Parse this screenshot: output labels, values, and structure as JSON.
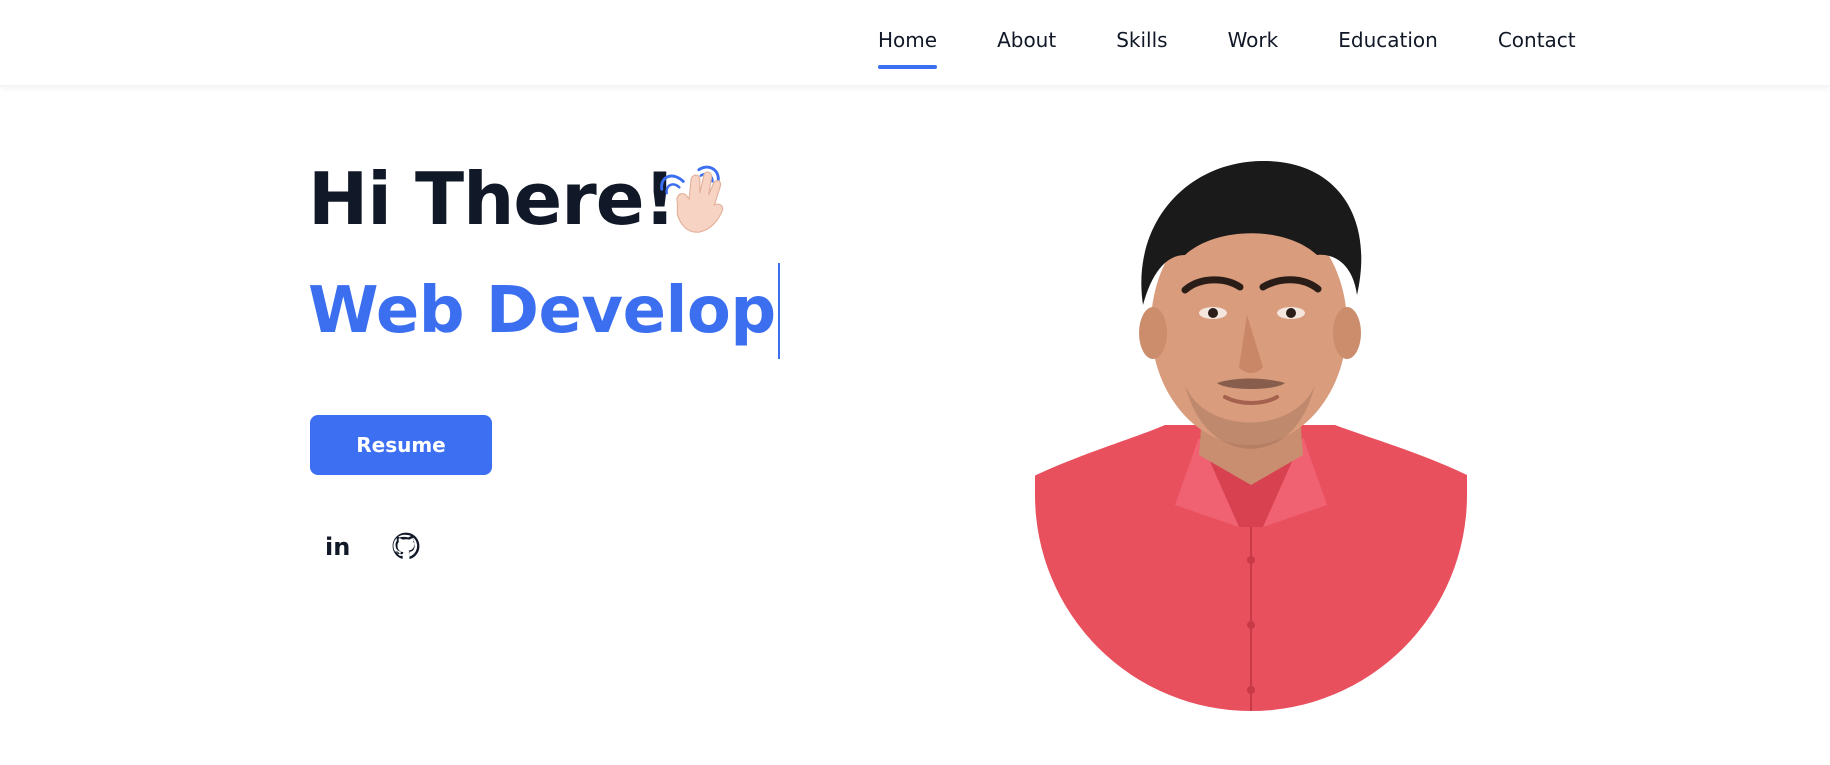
{
  "nav": {
    "items": [
      {
        "label": "Home",
        "active": true
      },
      {
        "label": "About",
        "active": false
      },
      {
        "label": "Skills",
        "active": false
      },
      {
        "label": "Work",
        "active": false
      },
      {
        "label": "Education",
        "active": false
      },
      {
        "label": "Contact",
        "active": false
      }
    ]
  },
  "hero": {
    "greeting": "Hi There!",
    "greeting_icon": "waving-hand-icon",
    "typed_role": "Web Develop",
    "resume_label": "Resume"
  },
  "social": [
    {
      "icon": "linkedin-icon",
      "label": "in"
    },
    {
      "icon": "github-icon"
    }
  ],
  "portrait": {
    "icon": "profile-photo"
  },
  "colors": {
    "accent": "#3b6ff0",
    "heading": "#111827",
    "background": "#ffffff",
    "shirt": "#e9505e",
    "skin": "#d99c7c",
    "hair": "#1a1a1a"
  }
}
